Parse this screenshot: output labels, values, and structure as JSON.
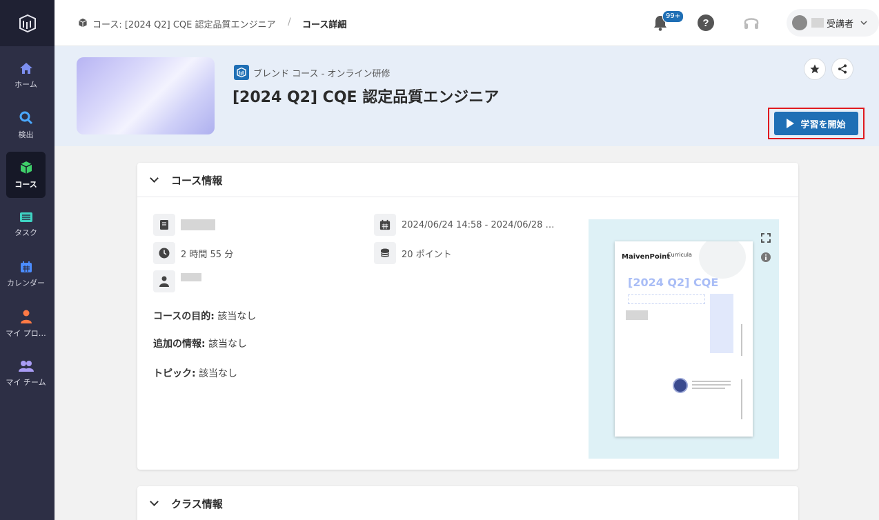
{
  "sidebar": {
    "items": [
      {
        "label": "ホーム",
        "icon": "home-icon"
      },
      {
        "label": "検出",
        "icon": "search-icon"
      },
      {
        "label": "コース",
        "icon": "cube-icon"
      },
      {
        "label": "タスク",
        "icon": "task-icon"
      },
      {
        "label": "カレンダー",
        "icon": "calendar-icon"
      },
      {
        "label": "マイ プロ…",
        "icon": "user-icon"
      },
      {
        "label": "マイ チーム",
        "icon": "team-icon"
      }
    ],
    "active_index": 2
  },
  "topbar": {
    "breadcrumb_course": "コース: [2024 Q2] CQE 認定品質エンジニア",
    "breadcrumb_separator": "/",
    "breadcrumb_current": "コース詳細",
    "notification_badge": "99+",
    "user_role": "受講者"
  },
  "header": {
    "course_type": "ブレンド コース - オンライン研修",
    "course_title": "[2024 Q2] CQE 認定品質エンジニア",
    "start_button_label": "学習を開始"
  },
  "course_info": {
    "section_title": "コース情報",
    "duration": "2 時間 55 分",
    "date_range": "2024/06/24 14:58 - 2024/06/28 …",
    "points": "20 ポイント",
    "objective_label": "コースの目的:",
    "objective_value": "該当なし",
    "additional_label": "追加の情報:",
    "additional_value": "該当なし",
    "topic_label": "トピック:",
    "topic_value": "該当なし"
  },
  "preview": {
    "brand": "MaivenPoint",
    "brand_secondary": "Curricula",
    "title": "[2024 Q2] CQE"
  },
  "class_info": {
    "section_title": "クラス情報"
  },
  "colors": {
    "sidebar_bg": "#2d2f45",
    "accent_blue": "#1f6fb5",
    "highlight_red": "#e0191f",
    "band_bg": "#e7eef8"
  }
}
